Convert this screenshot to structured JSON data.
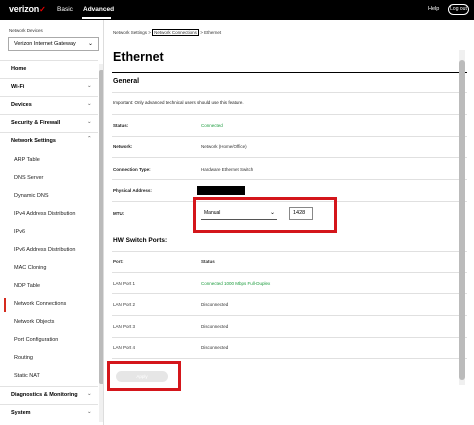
{
  "header": {
    "logo_text": "verizon",
    "logo_check": "✓",
    "tabs": [
      {
        "label": "Basic"
      },
      {
        "label": "Advanced"
      }
    ],
    "help_label": "Help",
    "logout_label": "Log out"
  },
  "sidebar": {
    "devices_label": "Network Devices",
    "selected_device": "Verizon Internet Gateway",
    "top_items": [
      {
        "label": "Home"
      },
      {
        "label": "Wi-Fi"
      },
      {
        "label": "Devices"
      },
      {
        "label": "Security & Firewall"
      },
      {
        "label": "Network Settings"
      }
    ],
    "sub_items": [
      {
        "label": "ARP Table"
      },
      {
        "label": "DNS Server"
      },
      {
        "label": "Dynamic DNS"
      },
      {
        "label": "IPv4 Address Distribution"
      },
      {
        "label": "IPv6"
      },
      {
        "label": "IPv6 Address Distribution"
      },
      {
        "label": "MAC Cloning"
      },
      {
        "label": "NDP Table"
      },
      {
        "label": "Network Connections"
      },
      {
        "label": "Network Objects"
      },
      {
        "label": "Port Configuration"
      },
      {
        "label": "Routing"
      },
      {
        "label": "Static NAT"
      }
    ],
    "bottom_items": [
      {
        "label": "Diagnostics & Monitoring"
      },
      {
        "label": "System"
      }
    ],
    "active_sub": "Network Connections"
  },
  "breadcrumb": {
    "part1": "Network Settings",
    "sep": " > ",
    "part2": "Network Connections",
    "part3": "Ethernet"
  },
  "page": {
    "title": "Ethernet",
    "general_heading": "General",
    "note": "Important: Only advanced technical users should use this feature.",
    "fields": [
      {
        "label": "Status:",
        "value": "Connected",
        "color": "#1a9b3c"
      },
      {
        "label": "Network:",
        "value": "Network (Home/Office)"
      },
      {
        "label": "Connection Type:",
        "value": "Hardware Ethernet Switch"
      },
      {
        "label": "Physical Address:",
        "value": ""
      }
    ],
    "mtu": {
      "label": "MTU:",
      "mode": "Manual",
      "value": "1428"
    },
    "hw_heading": "HW Switch Ports:",
    "ports_header": {
      "port": "Port:",
      "status": "Status"
    },
    "ports": [
      {
        "port": "LAN Port 1",
        "status": "Connected 1000 Mbps Full-Duplex",
        "color": "#1a9b3c"
      },
      {
        "port": "LAN Port 2",
        "status": "Disconnected"
      },
      {
        "port": "LAN Port 3",
        "status": "Disconnected"
      },
      {
        "port": "LAN Port 4",
        "status": "Disconnected"
      }
    ],
    "apply_label": "Apply"
  }
}
